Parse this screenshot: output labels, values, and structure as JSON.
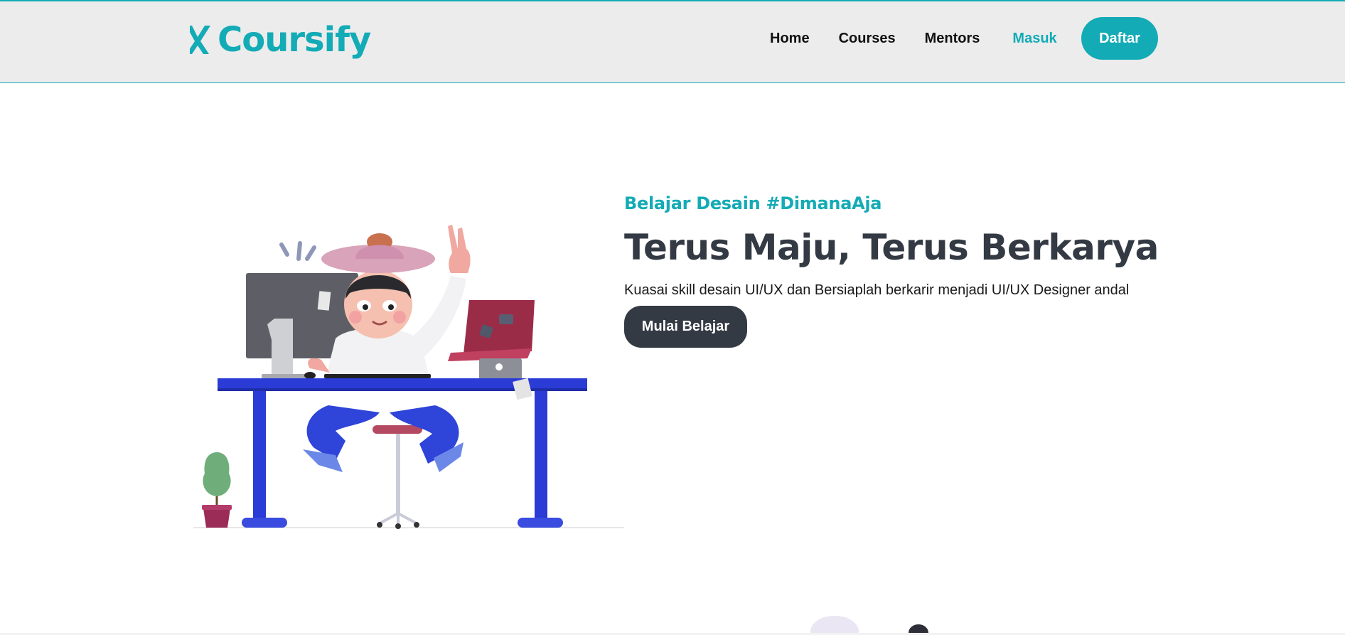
{
  "brand": {
    "name": "Coursify",
    "icon": "x-logo-icon",
    "color": "#13abb6"
  },
  "nav": {
    "items": [
      {
        "label": "Home"
      },
      {
        "label": "Courses"
      },
      {
        "label": "Mentors"
      },
      {
        "label": "Masuk",
        "active": true
      }
    ],
    "cta_label": "Daftar"
  },
  "hero": {
    "eyebrow": "Belajar Desain #DimanaAja",
    "headline": "Terus Maju, Terus Berkarya",
    "subtext": "Kuasai skill desain UI/UX dan Bersiaplah berkarir menjadi UI/UX Designer andal",
    "cta_label": "Mulai Belajar",
    "illustration": "person-at-desk-illustration"
  },
  "colors": {
    "accent": "#13abb6",
    "dark": "#343a44",
    "navbar_bg": "#ececec",
    "desk_blue": "#2a3bd6"
  }
}
